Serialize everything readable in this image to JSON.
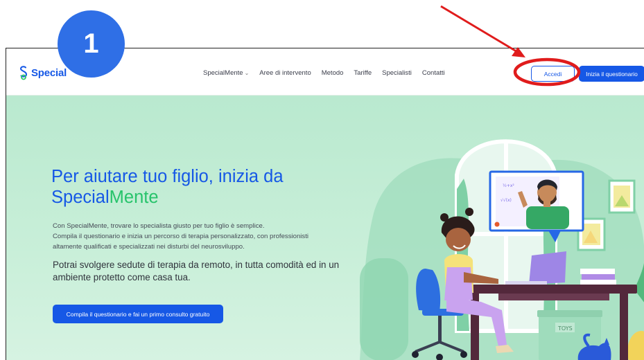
{
  "annotation": {
    "step_number": "1",
    "badge_color": "#2f6fe6",
    "marker_color": "#e01c1c"
  },
  "brand": {
    "name_part1": "Special",
    "name_part2": "Mente",
    "primary": "#1658e6",
    "green": "#27c36b"
  },
  "nav": {
    "items": [
      {
        "label": "SpecialMente",
        "has_dropdown": true
      },
      {
        "label": "Aree di intervento",
        "has_dropdown": false
      },
      {
        "label": "Metodo",
        "has_dropdown": false
      },
      {
        "label": "Tariffe",
        "has_dropdown": false
      },
      {
        "label": "Specialisti",
        "has_dropdown": false
      },
      {
        "label": "Contatti",
        "has_dropdown": false
      }
    ],
    "login_label": "Accedi",
    "questionnaire_label": "Inizia il questionario"
  },
  "hero": {
    "title_line1": "Per aiutare tuo figlio, inizia da",
    "title_line2_part1": "Special",
    "title_line2_part2": "Mente",
    "paragraph1_lines": [
      "Con SpecialMente, trovare lo specialista giusto per tuo figlio è semplice.",
      "Compila il questionario e inizia un percorso di terapia personalizzato, con professionisti",
      "altamente qualificati e specializzati nei disturbi del neurosviluppo."
    ],
    "paragraph2_lines": [
      "Potrai svolgere sedute di terapia da remoto, in tutta comodità ed in un",
      "ambiente protetto come casa tua."
    ],
    "cta_label": "Compila il questionario e fai un primo consulto gratuito",
    "toy_box_label": "TOYS",
    "background_color": "#b9e9cf"
  }
}
